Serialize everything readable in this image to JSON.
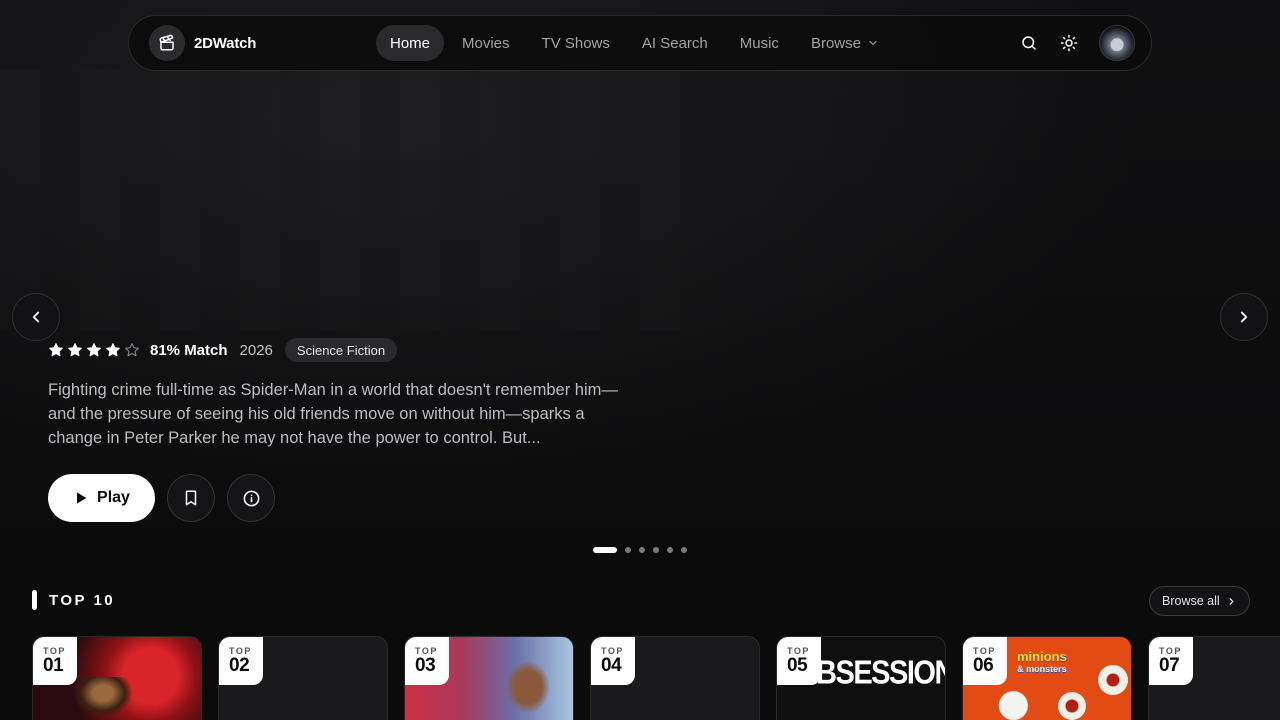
{
  "app": {
    "name": "2DWatch"
  },
  "nav": {
    "links": [
      {
        "label": "Home",
        "active": true
      },
      {
        "label": "Movies",
        "active": false
      },
      {
        "label": "TV Shows",
        "active": false
      },
      {
        "label": "AI Search",
        "active": false
      },
      {
        "label": "Music",
        "active": false
      },
      {
        "label": "Browse",
        "active": false,
        "dropdown": true
      }
    ],
    "icons": [
      "search-icon",
      "sun-icon"
    ]
  },
  "hero": {
    "rating_stars": 4,
    "rating_max": 5,
    "match": "81% Match",
    "year": "2026",
    "genre": "Science Fiction",
    "description": "Fighting crime full-time as Spider-Man in a world that doesn't remember him—and the pressure of seeing his old friends move on without him—sparks a change in Peter Parker he may not have the power to control. But...",
    "play_label": "Play",
    "slide_count": 6,
    "active_slide": 0
  },
  "top10": {
    "title": "TOP 10",
    "browse_all": "Browse all",
    "rank_prefix": "TOP",
    "items": [
      {
        "rank": "01"
      },
      {
        "rank": "02"
      },
      {
        "rank": "03"
      },
      {
        "rank": "04"
      },
      {
        "rank": "05",
        "title_art": "OBSESSION"
      },
      {
        "rank": "06",
        "title_art": "minions",
        "title_art_sub": "& monsters"
      },
      {
        "rank": "07"
      }
    ]
  },
  "colors": {
    "background": "#0b0b0c",
    "surface": "#2a2a2d",
    "text": "#ffffff",
    "muted": "#a3a3a8"
  }
}
